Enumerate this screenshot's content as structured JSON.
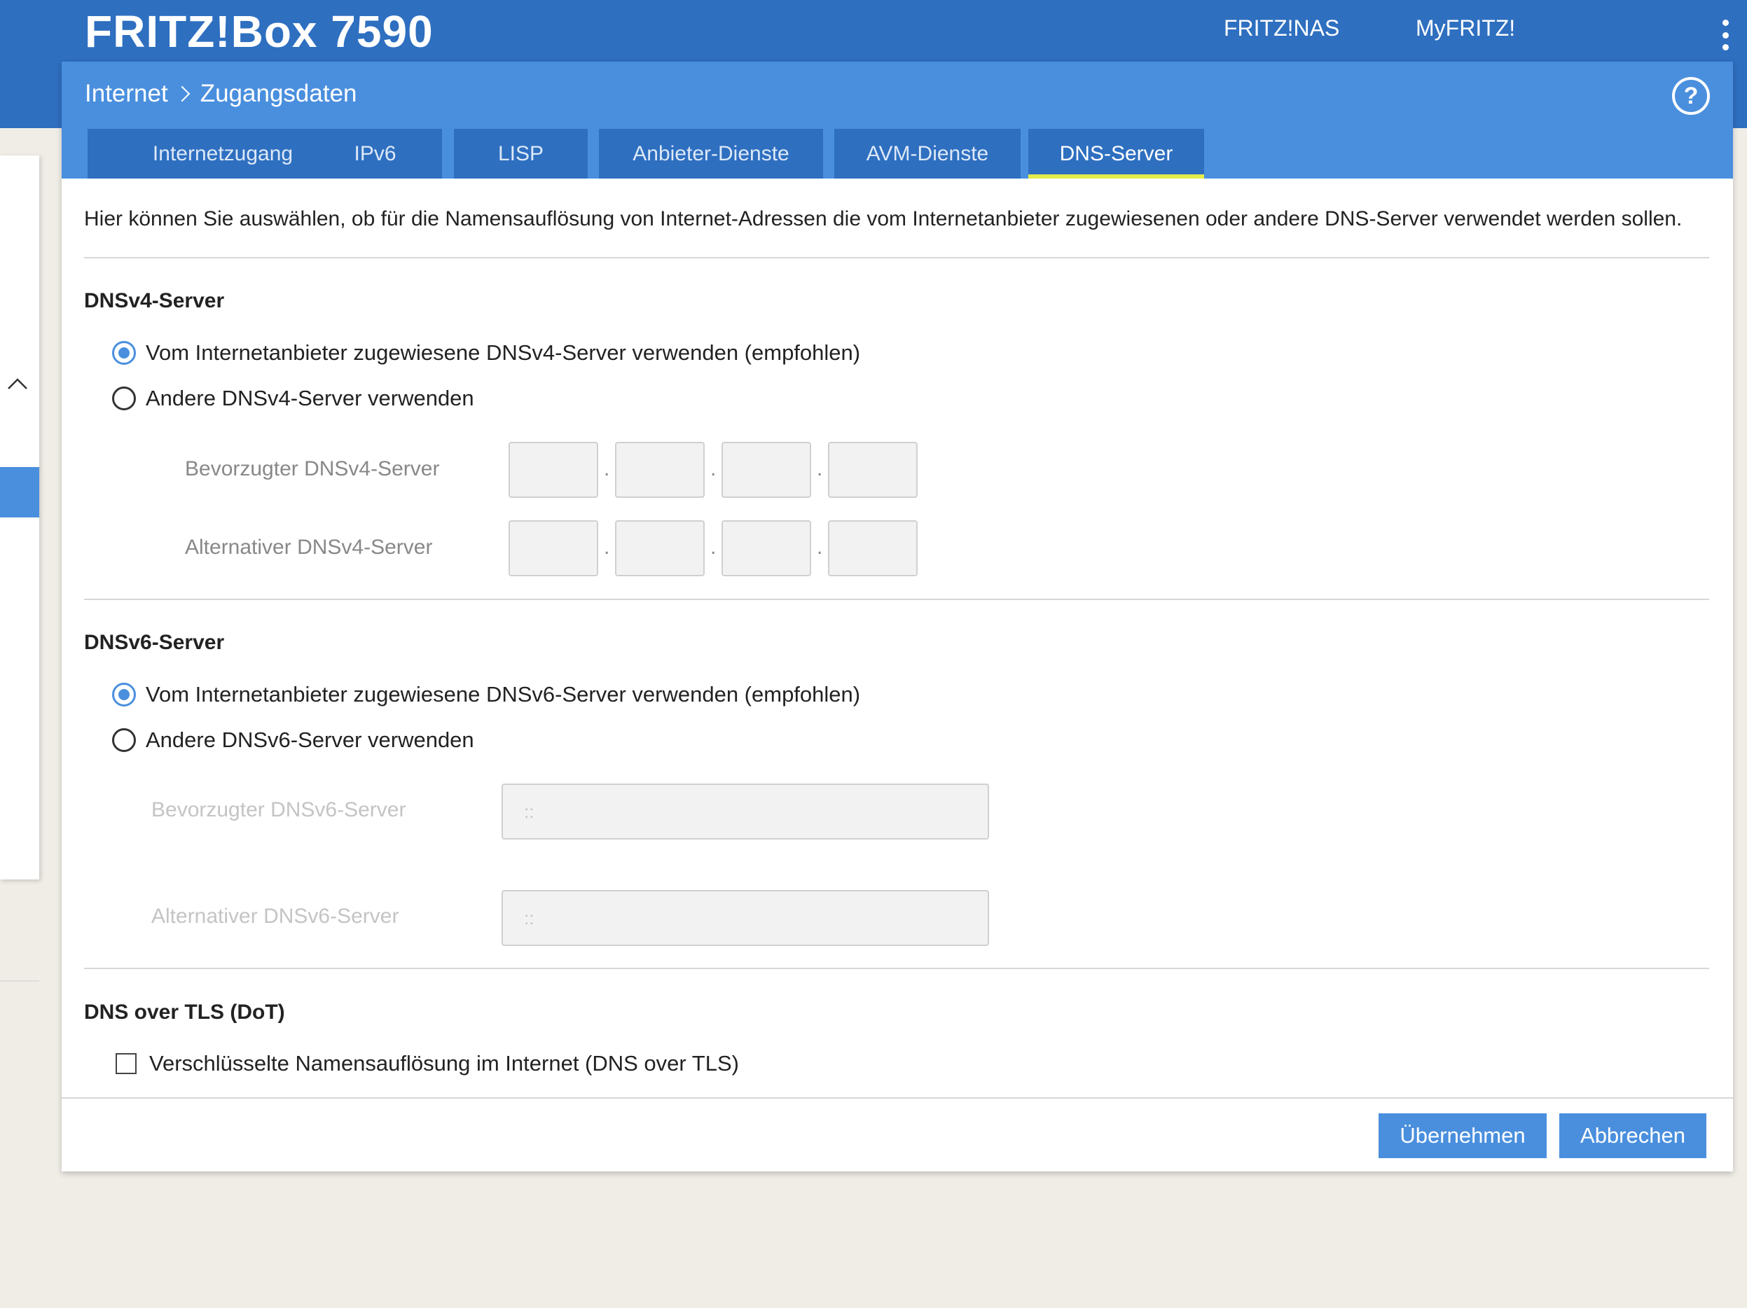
{
  "header": {
    "brand": "FRITZ!Box 7590",
    "links": [
      "FRITZ!NAS",
      "MyFRITZ!"
    ]
  },
  "breadcrumb": {
    "parent": "Internet",
    "current": "Zugangsdaten"
  },
  "help_label": "?",
  "tabs": [
    {
      "label": "Internetzugang"
    },
    {
      "label": "IPv6"
    },
    {
      "label": "LISP"
    },
    {
      "label": "Anbieter-Dienste"
    },
    {
      "label": "AVM-Dienste"
    },
    {
      "label": "DNS-Server",
      "active": true
    }
  ],
  "intro": "Hier können Sie auswählen, ob für die Namensauflösung von Internet-Adressen die vom Internetanbieter zugewiesenen oder andere DNS-Server verwendet werden sollen.",
  "dnsv4": {
    "title": "DNSv4-Server",
    "option_isp": "Vom Internetanbieter zugewiesene DNSv4-Server verwenden (empfohlen)",
    "option_other": "Andere DNSv4-Server verwenden",
    "selected": "isp",
    "preferred_label": "Bevorzugter DNSv4-Server",
    "alternative_label": "Alternativer DNSv4-Server",
    "separator": "."
  },
  "dnsv6": {
    "title": "DNSv6-Server",
    "option_isp": "Vom Internetanbieter zugewiesene DNSv6-Server verwenden (empfohlen)",
    "option_other": "Andere DNSv6-Server verwenden",
    "selected": "isp",
    "preferred_label": "Bevorzugter DNSv6-Server",
    "alternative_label": "Alternativer DNSv6-Server",
    "preferred_placeholder": "::",
    "alternative_placeholder": "::"
  },
  "dot": {
    "title": "DNS over TLS (DoT)",
    "checkbox_label": "Verschlüsselte Namensauflösung im Internet (DNS over TLS)",
    "checked": false
  },
  "buttons": {
    "apply": "Übernehmen",
    "cancel": "Abbrechen"
  },
  "colors": {
    "topbar": "#2e6fc0",
    "header": "#4a8fde",
    "active_tab_underline": "#e4ec4a",
    "button": "#4a8fde"
  }
}
